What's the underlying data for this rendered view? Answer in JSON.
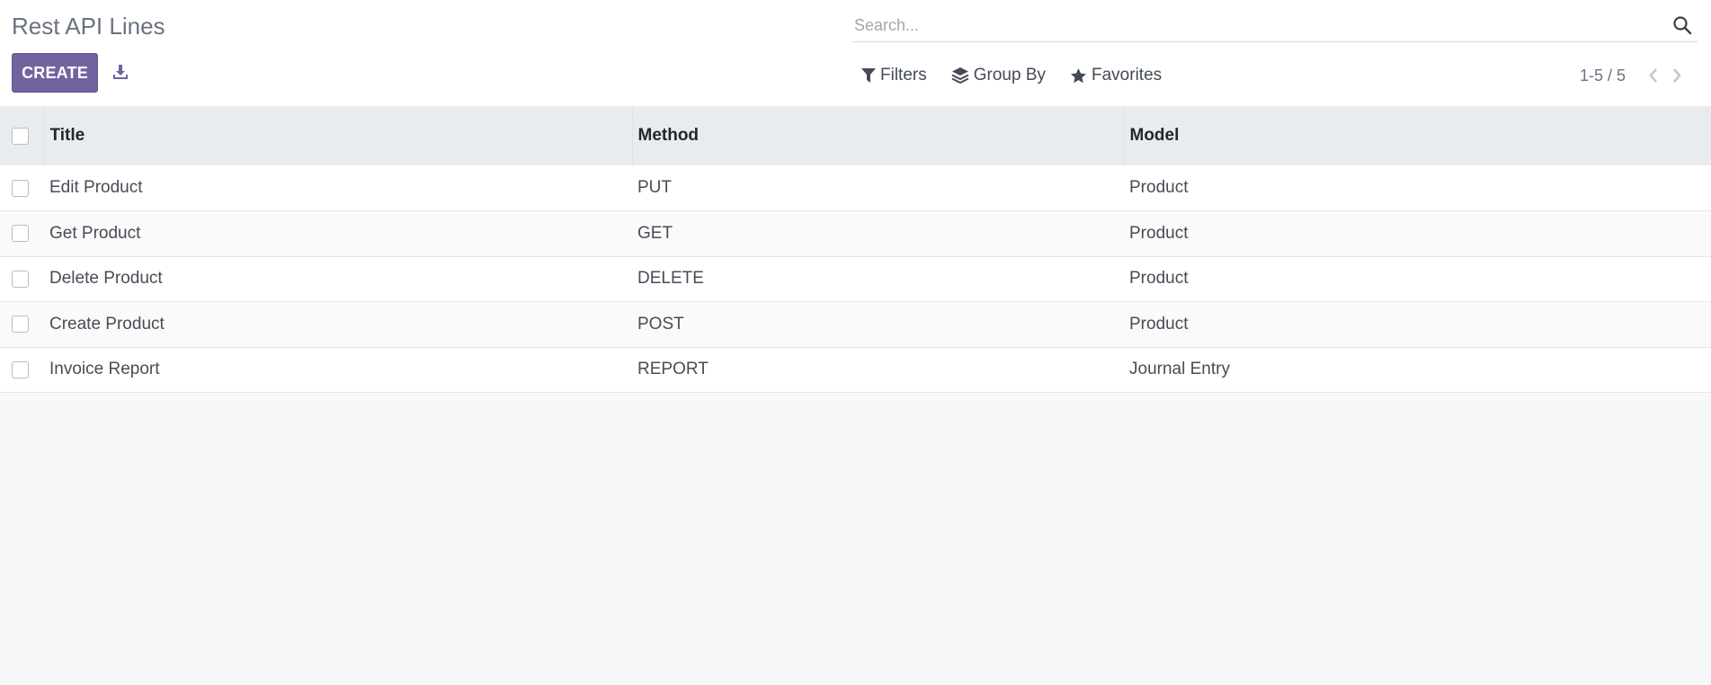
{
  "header": {
    "title": "Rest API Lines",
    "create_label": "CREATE"
  },
  "search": {
    "placeholder": "Search...",
    "value": ""
  },
  "filters": {
    "filters_label": "Filters",
    "group_by_label": "Group By",
    "favorites_label": "Favorites"
  },
  "pager": {
    "value": "1-5 / 5"
  },
  "table": {
    "columns": [
      "Title",
      "Method",
      "Model"
    ],
    "rows": [
      {
        "title": "Edit Product",
        "method": "PUT",
        "model": "Product"
      },
      {
        "title": "Get Product",
        "method": "GET",
        "model": "Product"
      },
      {
        "title": "Delete Product",
        "method": "DELETE",
        "model": "Product"
      },
      {
        "title": "Create Product",
        "method": "POST",
        "model": "Product"
      },
      {
        "title": "Invoice Report",
        "method": "REPORT",
        "model": "Journal Entry"
      }
    ]
  },
  "colors": {
    "accent": "#71639e",
    "header_bg": "#e9ecef",
    "page_bg": "#f7f8fa"
  },
  "icons": {
    "download": "download-icon",
    "search": "search-icon",
    "filter": "filter-icon",
    "group_by": "layers-icon",
    "favorites": "star-icon",
    "prev": "chevron-left-icon",
    "next": "chevron-right-icon"
  }
}
